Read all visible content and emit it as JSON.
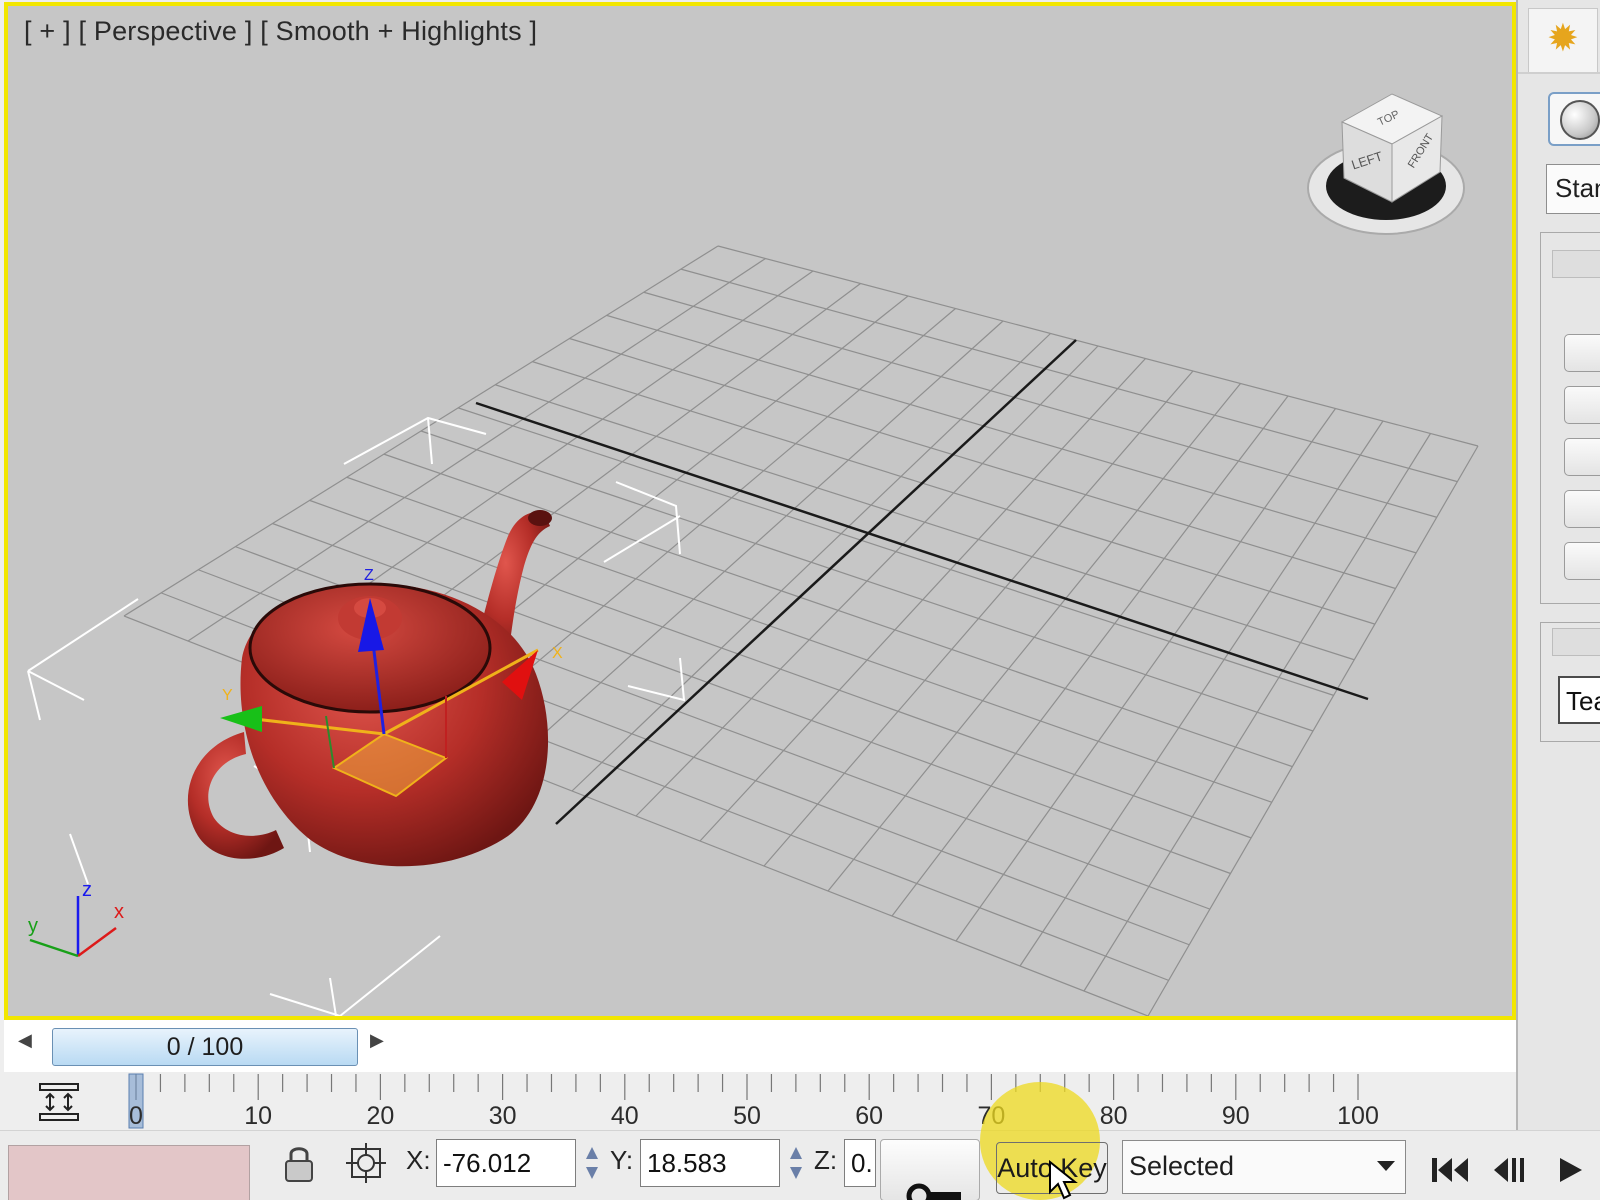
{
  "viewport": {
    "label": "[ + ] [ Perspective ] [ Smooth + Highlights ]",
    "border_color": "#f2e600",
    "background_color": "#c6c6c6",
    "object_color": "#b52e28",
    "viewcube_faces": [
      "TOP",
      "LEFT",
      "FRONT"
    ],
    "axis_tripod_labels": [
      "z",
      "y",
      "x"
    ]
  },
  "command_panel": {
    "tab_icon": "sun-star-icon",
    "primitive_button_icon": "sphere-icon",
    "dropdown_value": "Stan",
    "name_field_value": "Tea"
  },
  "time_slider": {
    "label": "0 / 100",
    "prev_icon": "triangle-left-icon",
    "next_icon": "triangle-right-icon"
  },
  "track_bar": {
    "tick_labels": [
      "0",
      "10",
      "20",
      "30",
      "40",
      "50",
      "60",
      "70",
      "80",
      "90",
      "100"
    ],
    "current_frame": 0,
    "filter_icon": "track-filter-icon"
  },
  "status_bar": {
    "lock_icon": "lock-icon",
    "absolute_mode_icon": "absolute-transform-icon",
    "x_label": "X:",
    "x_value": "-76.012",
    "y_label": "Y:",
    "y_value": "18.583",
    "z_label": "Z:",
    "z_value": "0.",
    "set_key_icon": "key-icon",
    "auto_key_label": "Auto Key",
    "auto_key_highlight": "#eeda1e",
    "key_filter_value": "Selected",
    "playback_icons": [
      "go-to-start-icon",
      "previous-frame-icon",
      "play-icon"
    ]
  }
}
